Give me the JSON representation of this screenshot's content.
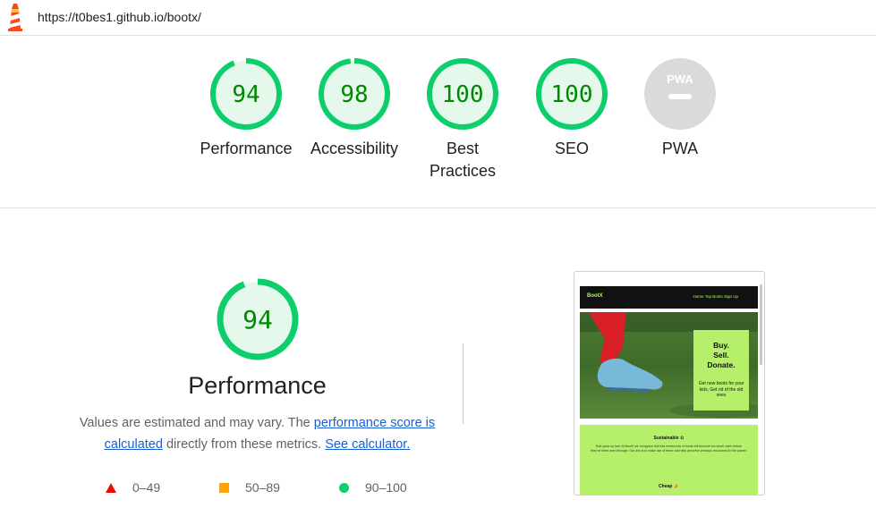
{
  "header": {
    "url": "https://t0bes1.github.io/bootx/"
  },
  "gauges": [
    {
      "score": "94",
      "label_line1": "Performance",
      "label_line2": "",
      "fraction": 0.94
    },
    {
      "score": "98",
      "label_line1": "Accessibility",
      "label_line2": "",
      "fraction": 0.98
    },
    {
      "score": "100",
      "label_line1": "Best",
      "label_line2": "Practices",
      "fraction": 1.0
    },
    {
      "score": "100",
      "label_line1": "SEO",
      "label_line2": "",
      "fraction": 1.0
    },
    {
      "score": "PWA",
      "label_line1": "PWA",
      "label_line2": "",
      "fraction": 0
    }
  ],
  "performance": {
    "score": "94",
    "fraction": 0.94,
    "title": "Performance",
    "desc_prefix": "Values are estimated and may vary. The ",
    "desc_link1": "performance score is calculated",
    "desc_middle": " directly from these metrics. ",
    "desc_link2": "See calculator."
  },
  "legend": {
    "fail": "0–49",
    "average": "50–89",
    "pass": "90–100"
  },
  "thumbnail": {
    "brand": "BootX",
    "nav_links": "Home   Top Boots   Sign Up",
    "card_head_1": "Buy.",
    "card_head_2": "Sell.",
    "card_head_3": "Donate.",
    "card_body": "Get new boots for your kids, Get rid of the old ones",
    "section_title": "Sustainable ♻",
    "section_body": "Kids grow up fast. At BootX we recognise that this means lots of boots will become too small, even before they've been worn through. Our aim is to make use of these and help preserve precious resources for the planet.",
    "section_title2": "Cheap 💰"
  },
  "colors": {
    "pass": "#0cce6b",
    "pass_text": "#008800",
    "pass_fill": "#e5f8ec",
    "average": "#ffa400",
    "fail": "#eb0f00",
    "link": "#1a5fd1",
    "pwa_gray": "#dadada"
  }
}
